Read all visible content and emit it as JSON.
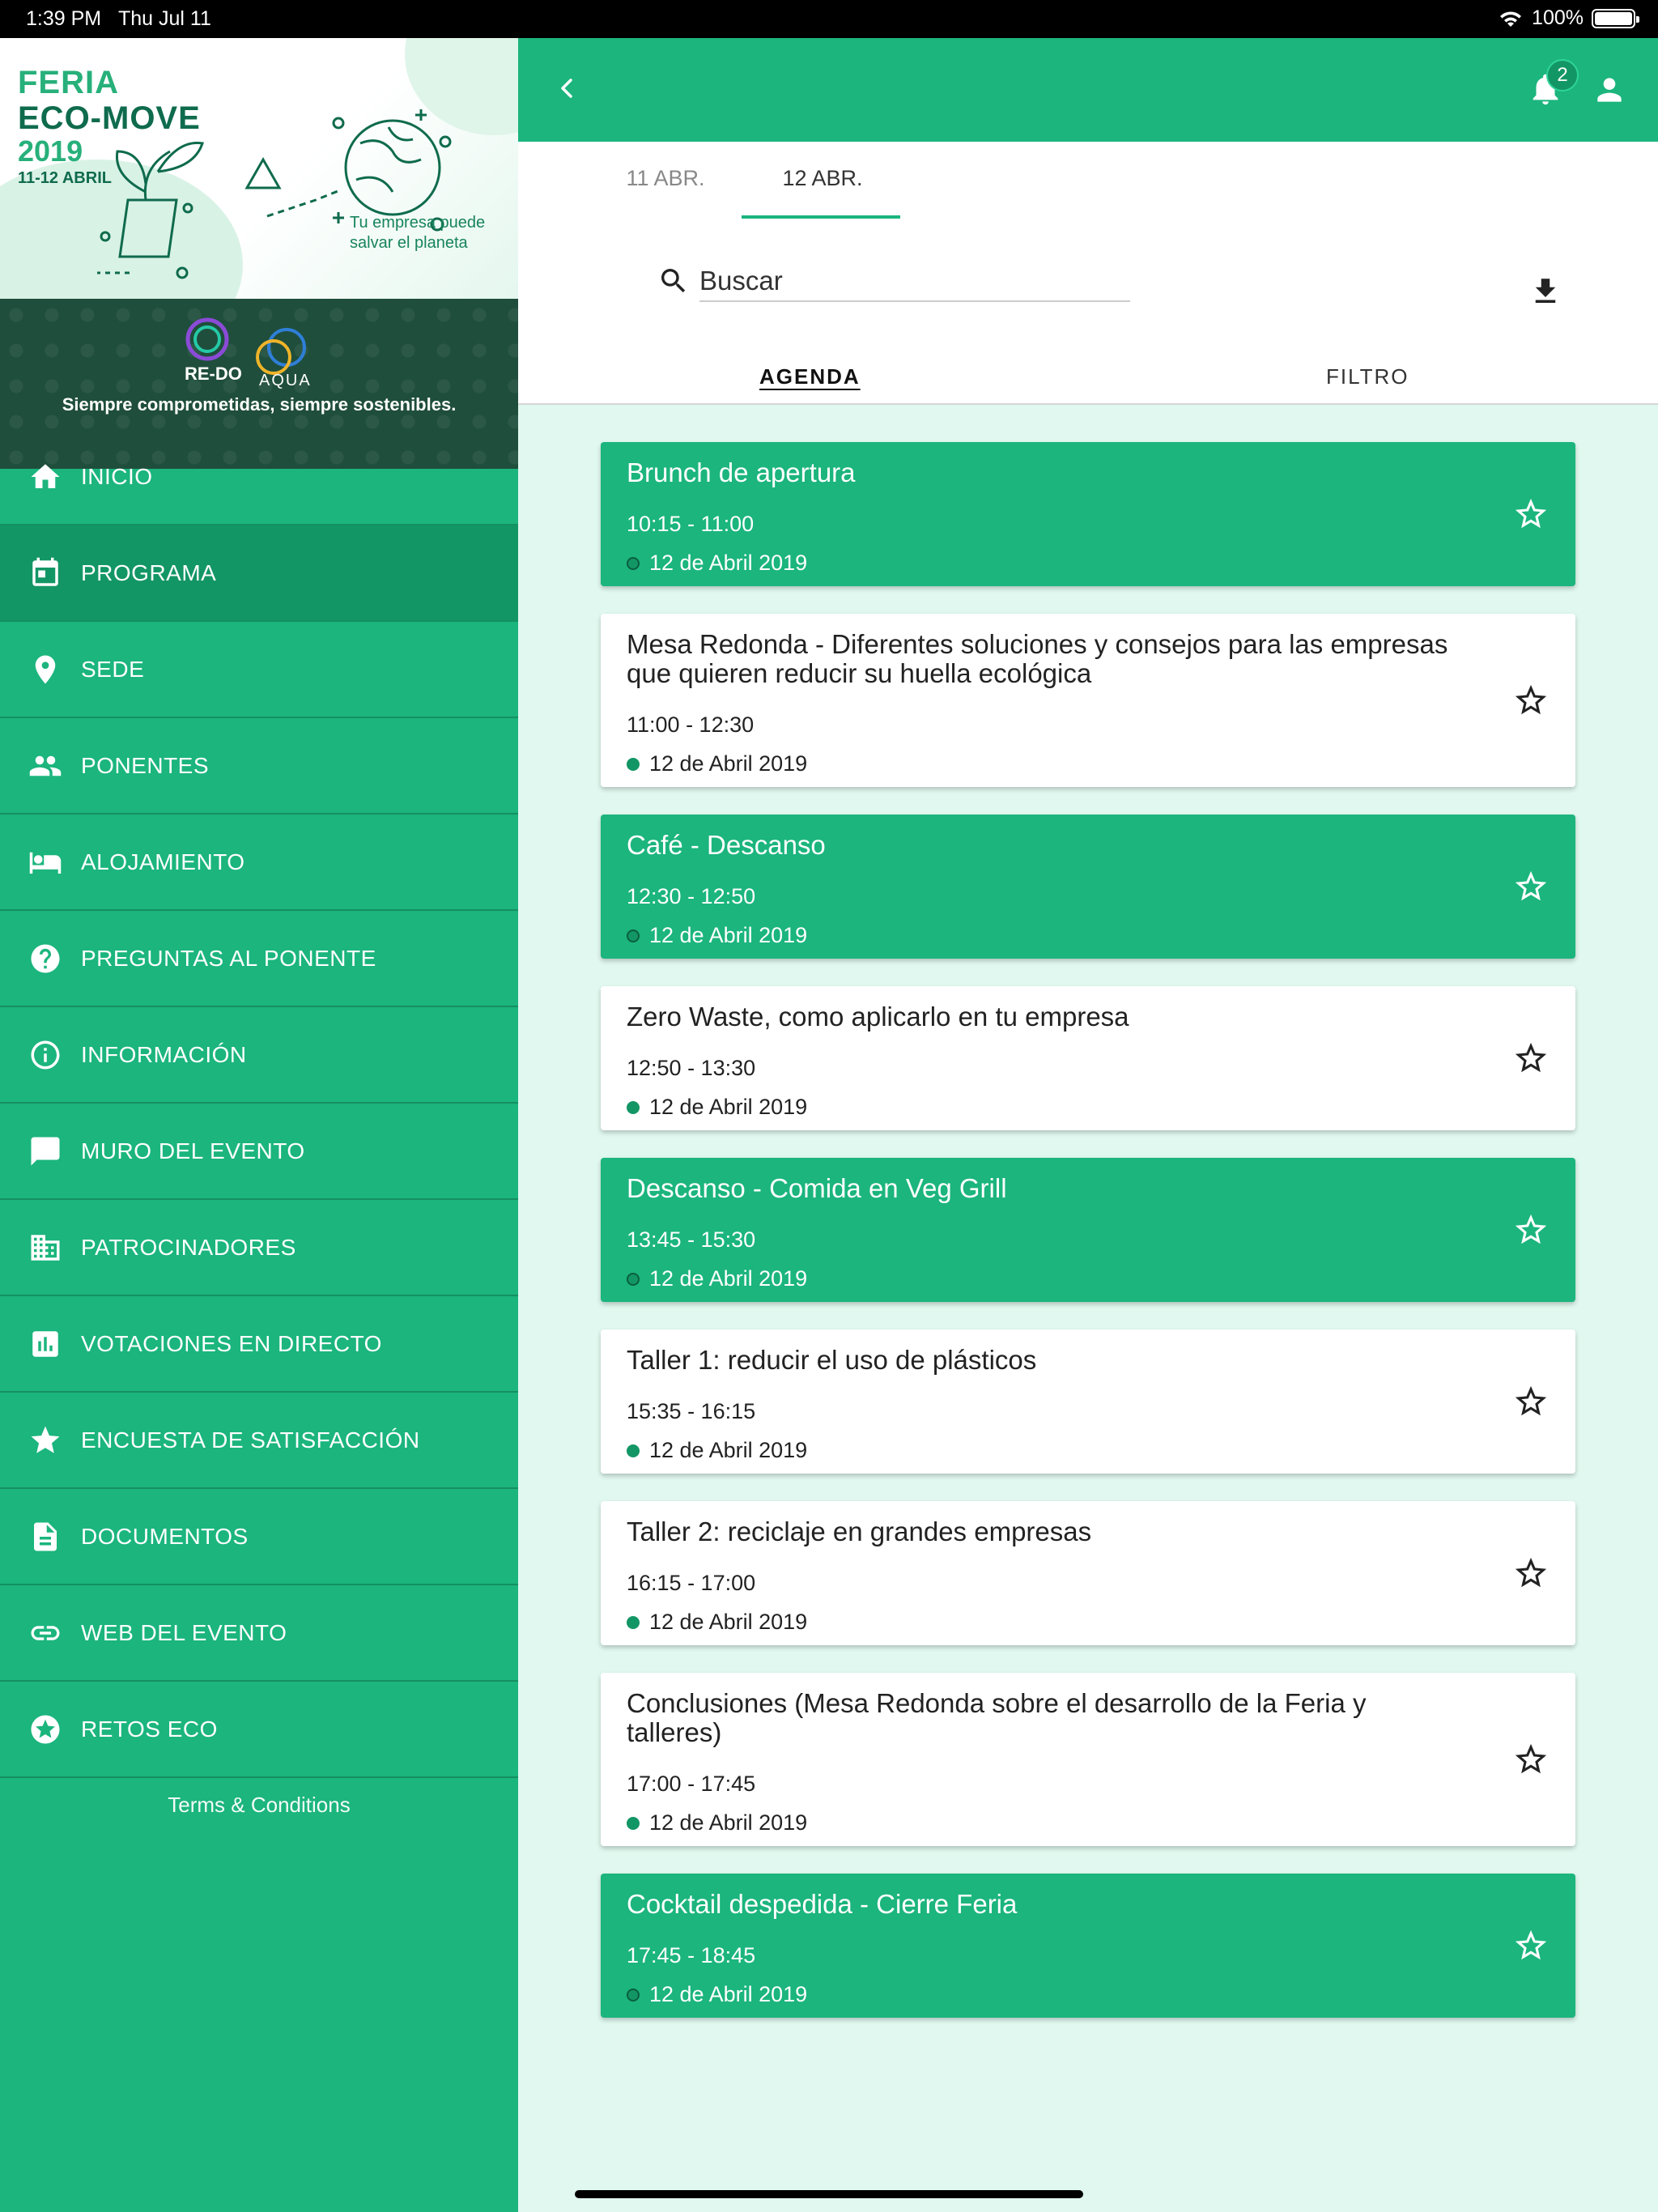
{
  "status": {
    "time": "1:39 PM",
    "date": "Thu Jul 11",
    "battery": "100%"
  },
  "banner": {
    "line1": "FERIA",
    "line2": "ECO-MOVE",
    "year": "2019",
    "dates": "11-12 ABRIL",
    "tagline": "Tu empresa puede salvar el planeta"
  },
  "sponsors": {
    "redo": "RE-DO",
    "aqua": "AQUA",
    "slogan": "Siempre comprometidas, siempre sostenibles."
  },
  "menu": [
    {
      "label": "INICIO",
      "icon": "home-icon"
    },
    {
      "label": "PROGRAMA",
      "icon": "calendar-icon",
      "active": true
    },
    {
      "label": "SEDE",
      "icon": "location-pin-icon"
    },
    {
      "label": "PONENTES",
      "icon": "people-icon"
    },
    {
      "label": "ALOJAMIENTO",
      "icon": "hotel-bed-icon"
    },
    {
      "label": "PREGUNTAS AL PONENTE",
      "icon": "help-circle-icon"
    },
    {
      "label": "INFORMACIÓN",
      "icon": "info-icon"
    },
    {
      "label": "MURO DEL EVENTO",
      "icon": "chat-bubble-icon"
    },
    {
      "label": "PATROCINADORES",
      "icon": "building-icon"
    },
    {
      "label": "VOTACIONES EN DIRECTO",
      "icon": "poll-chart-icon"
    },
    {
      "label": "ENCUESTA DE SATISFACCIÓN",
      "icon": "star-icon"
    },
    {
      "label": "DOCUMENTOS",
      "icon": "document-icon"
    },
    {
      "label": "WEB DEL EVENTO",
      "icon": "link-icon"
    },
    {
      "label": "RETOS ECO",
      "icon": "star-circle-icon"
    }
  ],
  "terms": "Terms & Conditions",
  "appbar": {
    "notification_count": "2"
  },
  "date_tabs": [
    "11 ABR.",
    "12 ABR."
  ],
  "search": {
    "placeholder": "Buscar"
  },
  "sub_tabs": {
    "agenda": "AGENDA",
    "filtro": "FILTRO"
  },
  "sessions": [
    {
      "title": "Brunch de apertura",
      "time": "10:15 - 11:00",
      "date": "12 de Abril 2019",
      "style": "green"
    },
    {
      "title": "Mesa Redonda - Diferentes soluciones y consejos para las empresas que quieren reducir su huella ecológica",
      "time": "11:00 - 12:30",
      "date": "12 de Abril 2019",
      "style": "white"
    },
    {
      "title": "Café - Descanso",
      "time": "12:30 - 12:50",
      "date": "12 de Abril 2019",
      "style": "green"
    },
    {
      "title": "Zero Waste, como aplicarlo en tu empresa",
      "time": "12:50 - 13:30",
      "date": "12 de Abril 2019",
      "style": "white"
    },
    {
      "title": "Descanso - Comida en Veg Grill",
      "time": "13:45 - 15:30",
      "date": "12 de Abril 2019",
      "style": "green"
    },
    {
      "title": "Taller 1: reducir el uso de plásticos",
      "time": "15:35 - 16:15",
      "date": "12 de Abril 2019",
      "style": "white"
    },
    {
      "title": "Taller 2: reciclaje en grandes empresas",
      "time": "16:15 - 17:00",
      "date": "12 de Abril 2019",
      "style": "white"
    },
    {
      "title": "Conclusiones (Mesa Redonda sobre el desarrollo de la Feria y talleres)",
      "time": "17:00 - 17:45",
      "date": "12 de Abril 2019",
      "style": "white"
    },
    {
      "title": "Cocktail despedida - Cierre Feria",
      "time": "17:45 - 18:45",
      "date": "12 de Abril 2019",
      "style": "green"
    }
  ],
  "colors": {
    "accent": "#1bb57d",
    "accent_dark": "#139665",
    "list_bg": "#e0f8ef",
    "sponsor_bg": "#1f4e3c"
  }
}
